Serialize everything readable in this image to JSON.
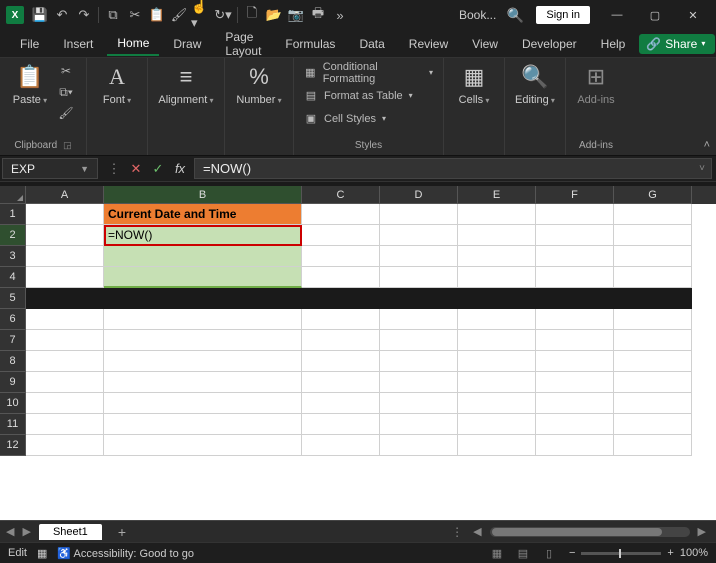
{
  "titlebar": {
    "doc_title": "Book...",
    "signin": "Sign in"
  },
  "tabs": {
    "file": "File",
    "insert": "Insert",
    "home": "Home",
    "draw": "Draw",
    "page_layout": "Page Layout",
    "formulas": "Formulas",
    "data": "Data",
    "review": "Review",
    "view": "View",
    "developer": "Developer",
    "help": "Help",
    "share": "Share"
  },
  "ribbon": {
    "clipboard": {
      "paste": "Paste",
      "label": "Clipboard"
    },
    "font": {
      "label": "Font",
      "btn": "Font"
    },
    "alignment": {
      "label": "Alignment",
      "btn": "Alignment"
    },
    "number": {
      "label": "Number",
      "btn": "Number"
    },
    "styles": {
      "cond": "Conditional Formatting",
      "table": "Format as Table",
      "cell": "Cell Styles",
      "label": "Styles"
    },
    "cells": {
      "btn": "Cells"
    },
    "editing": {
      "btn": "Editing"
    },
    "addins": {
      "btn": "Add-ins",
      "label": "Add-ins"
    }
  },
  "namebox": "EXP",
  "formula": "=NOW()",
  "grid": {
    "columns": [
      "A",
      "B",
      "C",
      "D",
      "E",
      "F",
      "G"
    ],
    "row_labels": [
      "1",
      "2",
      "3",
      "4",
      "5",
      "6",
      "7",
      "8",
      "9",
      "10",
      "11",
      "12"
    ],
    "b1": "Current Date and Time",
    "b2_editing": "=NOW()"
  },
  "sheets": {
    "active": "Sheet1"
  },
  "status": {
    "mode": "Edit",
    "accessibility": "Accessibility: Good to go",
    "zoom": "100%"
  }
}
